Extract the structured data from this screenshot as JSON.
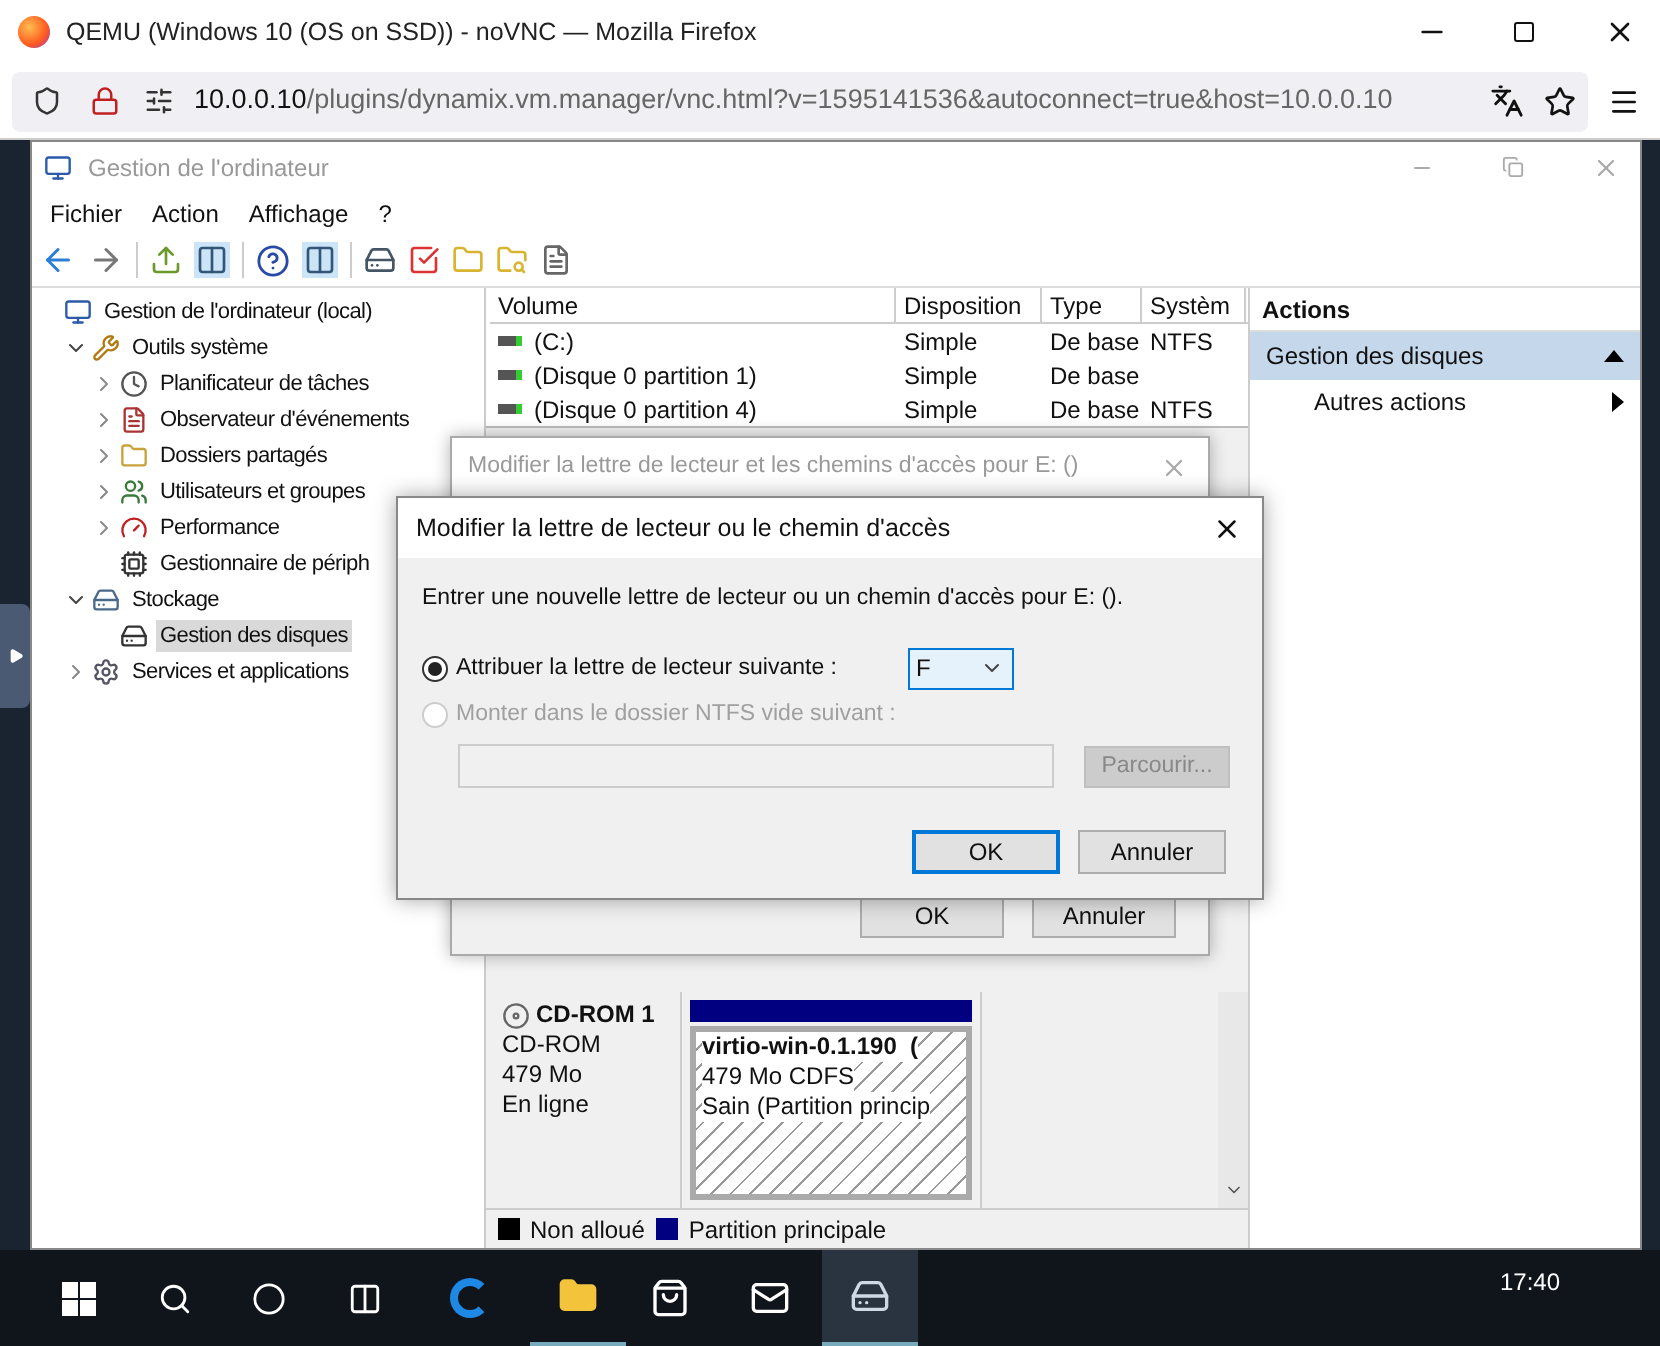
{
  "browser": {
    "title": "QEMU (Windows 10 (OS on SSD)) - noVNC — Mozilla Firefox",
    "url_host": "10.0.0.10",
    "url_path": "/plugins/dynamix.vm.manager/vnc.html?v=1595141536&autoconnect=true&host=10.0.0.10"
  },
  "window": {
    "title": "Gestion de l'ordinateur"
  },
  "menu": [
    "Fichier",
    "Action",
    "Affichage",
    "?"
  ],
  "tree": [
    {
      "label": "Gestion de l'ordinateur (local)",
      "selected": false,
      "children": [
        {
          "label": "Outils système",
          "expanded": true,
          "selected": false,
          "children": [
            {
              "label": "Planificateur de tâches",
              "expanded": false,
              "selected": false
            },
            {
              "label": "Observateur d'événements",
              "expanded": false,
              "selected": false
            },
            {
              "label": "Dossiers partagés",
              "expanded": false,
              "selected": false
            },
            {
              "label": "Utilisateurs et groupes",
              "expanded": false,
              "selected": false
            },
            {
              "label": "Performance",
              "expanded": false,
              "selected": false
            },
            {
              "label": "Gestionnaire de périph",
              "selected": false
            }
          ]
        },
        {
          "label": "Stockage",
          "expanded": true,
          "selected": false,
          "children": [
            {
              "label": "Gestion des disques",
              "selected": true
            }
          ]
        },
        {
          "label": "Services et applications",
          "expanded": false,
          "selected": false
        }
      ]
    }
  ],
  "volumes": {
    "columns": [
      "Volume",
      "Disposition",
      "Type",
      "Systèm"
    ],
    "rows": [
      {
        "volume": "(C:)",
        "layout": "Simple",
        "type": "De base",
        "fs": "NTFS"
      },
      {
        "volume": "(Disque 0 partition 1)",
        "layout": "Simple",
        "type": "De base"
      },
      {
        "volume": "(Disque 0 partition 4)",
        "layout": "Simple",
        "type": "De base",
        "fs": "NTFS"
      }
    ]
  },
  "disk": {
    "name": "CD-ROM 1",
    "kind": "CD-ROM",
    "size": "479 Mo",
    "status": "En ligne",
    "partition": {
      "name": "virtio-win-0.1.190  (",
      "info": "479 Mo CDFS",
      "status": "Sain (Partition princip",
      "color": "#000080"
    }
  },
  "legend": [
    {
      "label": "Non alloué",
      "color": "#000000"
    },
    {
      "label": "Partition principale",
      "color": "#000080"
    }
  ],
  "actions": {
    "title": "Actions",
    "section": {
      "label": "Gestion des disques",
      "expanded": true
    },
    "items": [
      "Autres actions"
    ]
  },
  "back_dialog": {
    "title": "Modifier la lettre de lecteur et les chemins d'accès pour E: ()",
    "buttons": [
      "OK",
      "Annuler"
    ]
  },
  "dialog": {
    "title": "Modifier la lettre de lecteur ou le chemin d'accès",
    "prompt": "Entrer une nouvelle lettre de lecteur ou un chemin d'accès pour E: ().",
    "options": [
      {
        "label": "Attribuer la lettre de lecteur suivante :",
        "selected": true,
        "disabled": false
      },
      {
        "label": "Monter dans le dossier NTFS vide suivant :",
        "selected": false,
        "disabled": true
      }
    ],
    "drive_letter": "F",
    "browse": {
      "label": "Parcourir...",
      "disabled": true
    },
    "buttons": [
      {
        "label": "OK",
        "default": true
      },
      {
        "label": "Annuler",
        "default": false
      }
    ]
  },
  "taskbar": {
    "clock": "17:40"
  }
}
